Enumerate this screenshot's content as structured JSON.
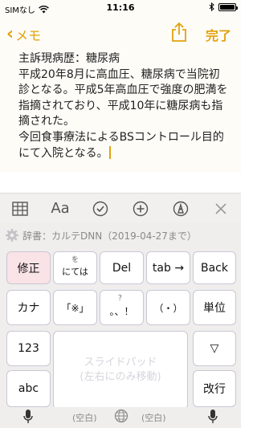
{
  "statusbar": {
    "carrier": "SIMなし",
    "time": "11:16"
  },
  "navbar": {
    "back_label": "メモ",
    "done_label": "完了"
  },
  "note": {
    "text": "主訴現病歴：糖尿病\n平成20年8月に高血圧、糖尿病で当院初診となる。平成5年高血圧で強度の肥満を指摘されており、平成10年に糖尿病も指摘された。\n今回食事療法によるBSコントロール目的にて入院となる。"
  },
  "format_toolbar": {
    "font_label": "Aa"
  },
  "dictionary": {
    "label": "辞書：カルテDNN（2019-04-27まで）"
  },
  "keyboard": {
    "correct": "修正",
    "wo_sub": "を",
    "wo_main": "にては",
    "del": "Del",
    "tab": "tab →",
    "back": "Back",
    "kana": "カナ",
    "bracket": "「※」",
    "punct_sub": "？",
    "punct_main": "。、！",
    "paren": "（・）",
    "unit": "単位",
    "num": "123",
    "triangle": "▽",
    "abc": "abc",
    "enter": "改行",
    "pad_line1": "スライドパッド",
    "pad_line2": "(左右にのみ移動)",
    "space_left": "(空白)",
    "space_right": "(空白)"
  },
  "colors": {
    "accent": "#e2a20e",
    "key_highlight": "#f9e3e6"
  }
}
